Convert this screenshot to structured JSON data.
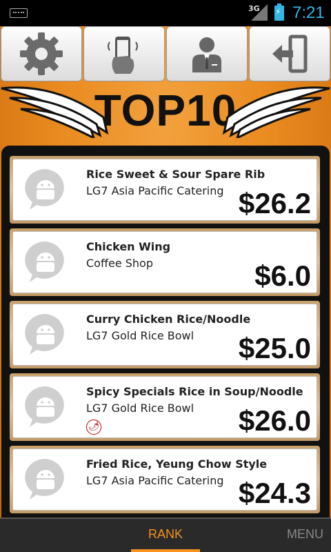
{
  "status_bar": {
    "network": "3G",
    "time": "7:21"
  },
  "toolbar": {
    "buttons": [
      {
        "icon": "gear-icon"
      },
      {
        "icon": "phone-shake-icon"
      },
      {
        "icon": "user-profile-icon"
      },
      {
        "icon": "logout-icon"
      }
    ]
  },
  "banner": {
    "title": "TOP10"
  },
  "items": [
    {
      "name": "Rice Sweet & Sour Spare Rib",
      "shop": "LG7 Asia Pacific Catering",
      "price": "$26.2"
    },
    {
      "name": "Chicken Wing",
      "shop": "Coffee Shop",
      "price": "$6.0"
    },
    {
      "name": "Curry Chicken Rice/Noodle",
      "shop": "LG7 Gold Rice Bowl",
      "price": "$25.0"
    },
    {
      "name": "Spicy Specials Rice in Soup/Noodle",
      "shop": "LG7 Gold Rice Bowl",
      "price": "$26.0",
      "badge_icon": "chili-icon"
    },
    {
      "name": "Fried Rice, Yeung Chow Style",
      "shop": "LG7 Asia Pacific Catering",
      "price": "$24.3"
    }
  ],
  "tabs": {
    "rank": "RANK",
    "menu": "MENU"
  },
  "colors": {
    "accent": "#f7931e",
    "status_blue": "#33b5e5",
    "background_orange": "#e98b1f"
  }
}
